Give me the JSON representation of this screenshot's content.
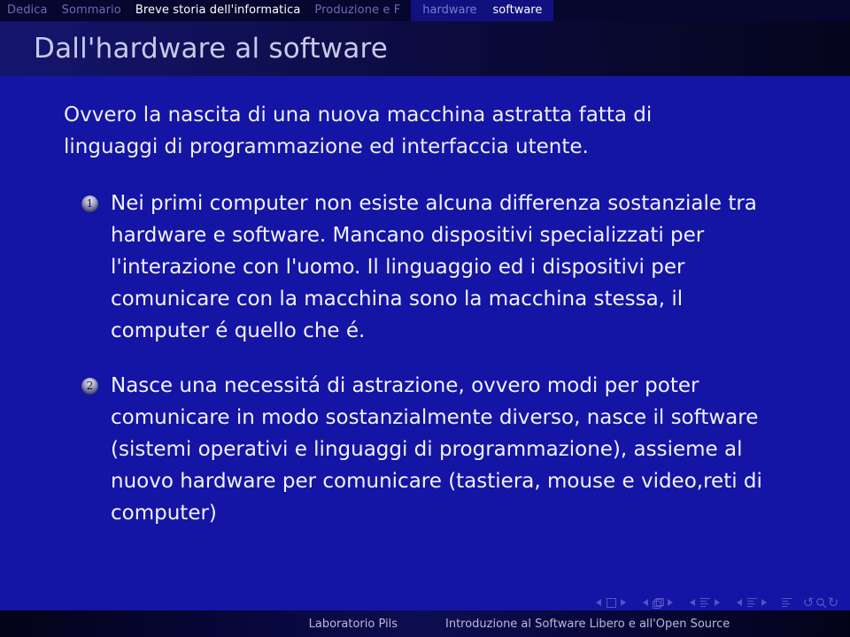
{
  "navbar": {
    "sections": [
      {
        "label": "Dedica",
        "current": false
      },
      {
        "label": "Sommario",
        "current": false
      },
      {
        "label": "Breve storia dell'informatica",
        "current": true
      },
      {
        "label": "Produzione e F",
        "current": false
      }
    ],
    "subsections": [
      {
        "label": "hardware",
        "current": false
      },
      {
        "label": "software",
        "current": true
      }
    ]
  },
  "title": "Dall'hardware al software",
  "intro": "Ovvero la nascita di una nuova macchina astratta fatta di linguaggi di programmazione ed interfaccia utente.",
  "items": [
    {
      "number": "1",
      "text": "Nei primi computer non esiste alcuna differenza sostanziale tra hardware e software. Mancano dispositivi specializzati per l'interazione con l'uomo. Il linguaggio ed i dispositivi per comunicare con la macchina sono la macchina stessa, il computer é quello che é."
    },
    {
      "number": "2",
      "text": "Nasce una necessitá di astrazione, ovvero modi per poter comunicare in modo sostanzialmente diverso, nasce il software (sistemi operativi e linguaggi di programmazione), assieme al nuovo hardware per comunicare (tastiera, mouse e video,reti di computer)"
    }
  ],
  "navigation_symbols": {
    "slide_prev": "prev-slide-icon",
    "slide_marker": "slide-icon",
    "slide_next": "next-slide-icon",
    "frame_prev": "prev-frame-icon",
    "frame_marker": "frame-icon",
    "frame_next": "next-frame-icon",
    "subsection_prev": "prev-subsection-icon",
    "subsection_marker": "subsection-icon",
    "subsection_next": "next-subsection-icon",
    "section_prev": "prev-section-icon",
    "section_marker": "section-icon",
    "section_next": "next-section-icon",
    "doc_marker": "document-icon",
    "back": "↺",
    "search": "search-icon",
    "forward": "↻"
  },
  "footer": {
    "left": "Laboratorio Pils",
    "right": "Introduzione al Software Libero e all'Open Source"
  },
  "colors": {
    "body_background": "#1414a5",
    "navbar_background": "#06062e",
    "title_text": "#c9c9e8",
    "body_text": "#f2f2f8",
    "inactive_nav": "#6b6bb5",
    "active_nav": "#ffffff"
  }
}
